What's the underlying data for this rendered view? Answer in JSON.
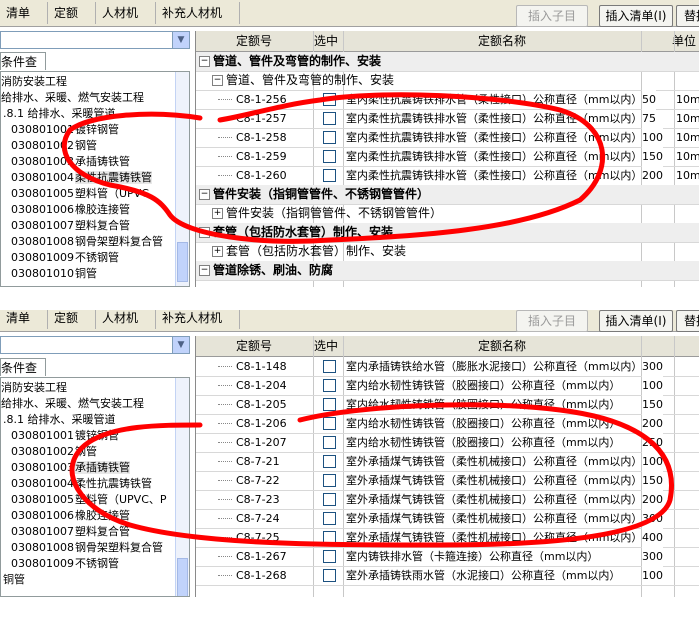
{
  "panels": [
    {
      "tabs": [
        "清单",
        "定额",
        "人材机",
        "补充人材机"
      ],
      "buttons": {
        "insert_child": "插入子目",
        "insert_list": "插入清单(I)",
        "replace": "替换"
      },
      "condition_tab": "条件查询",
      "tree": [
        {
          "code": "",
          "name": "消防安装工程"
        },
        {
          "code": "",
          "name": "给排水、采暖、燃气安装工程"
        },
        {
          "code": "",
          "name": ".8.1 给排水、采暖管道"
        },
        {
          "code": "030801001",
          "name": "镀锌钢管"
        },
        {
          "code": "030801002",
          "name": "钢管"
        },
        {
          "code": "030801003",
          "name": "承插铸铁管"
        },
        {
          "code": "030801004",
          "name": "柔性抗震铸铁管"
        },
        {
          "code": "030801005",
          "name": "塑料管（UPVC、"
        },
        {
          "code": "030801006",
          "name": "橡胶连接管"
        },
        {
          "code": "030801007",
          "name": "塑料复合管"
        },
        {
          "code": "030801008",
          "name": "钢骨架塑料复合管"
        },
        {
          "code": "030801009",
          "name": "不锈钢管"
        },
        {
          "code": "030801010",
          "name": "铜管"
        }
      ],
      "grid_header": {
        "code": "定额号",
        "select": "选中",
        "name": "定额名称",
        "unit": "单位"
      },
      "rows": [
        {
          "kind": "group",
          "code": "",
          "name": "管道、管件及弯管的制作、安装",
          "value": "",
          "unit": ""
        },
        {
          "kind": "subgroup",
          "code": "",
          "name": "管道、管件及弯管的制作、安装",
          "value": "",
          "unit": ""
        },
        {
          "kind": "item",
          "code": "C8-1-256",
          "name": "室内柔性抗震铸铁排水管（柔性接口）公称直径（mm以内）",
          "value": "50",
          "unit": "10m"
        },
        {
          "kind": "item",
          "code": "C8-1-257",
          "name": "室内柔性抗震铸铁排水管（柔性接口）公称直径（mm以内）",
          "value": "75",
          "unit": "10m"
        },
        {
          "kind": "item",
          "code": "C8-1-258",
          "name": "室内柔性抗震铸铁排水管（柔性接口）公称直径（mm以内）",
          "value": "100",
          "unit": "10m"
        },
        {
          "kind": "item",
          "code": "C8-1-259",
          "name": "室内柔性抗震铸铁排水管（柔性接口）公称直径（mm以内）",
          "value": "150",
          "unit": "10m"
        },
        {
          "kind": "item",
          "code": "C8-1-260",
          "name": "室内柔性抗震铸铁排水管（柔性接口）公称直径（mm以内）",
          "value": "200",
          "unit": "10m"
        },
        {
          "kind": "group",
          "code": "",
          "name": "管件安装（指铜管管件、不锈钢管管件）",
          "value": "",
          "unit": ""
        },
        {
          "kind": "subgroup",
          "code": "",
          "name": "管件安装（指铜管管件、不锈钢管管件）",
          "value": "",
          "unit": ""
        },
        {
          "kind": "group",
          "code": "",
          "name": "套管（包括防水套管）制作、安装",
          "value": "",
          "unit": ""
        },
        {
          "kind": "subgroup",
          "code": "",
          "name": "套管（包括防水套管）制作、安装",
          "value": "",
          "unit": ""
        },
        {
          "kind": "group",
          "code": "",
          "name": "管道除锈、刷油、防腐",
          "value": "",
          "unit": ""
        }
      ]
    },
    {
      "tabs": [
        "清单",
        "定额",
        "人材机",
        "补充人材机"
      ],
      "buttons": {
        "insert_child": "插入子目",
        "insert_list": "插入清单(I)",
        "replace": "替换"
      },
      "condition_tab": "条件查询",
      "tree": [
        {
          "code": "",
          "name": "消防安装工程"
        },
        {
          "code": "",
          "name": "给排水、采暖、燃气安装工程"
        },
        {
          "code": "",
          "name": ".8.1 给排水、采暖管道"
        },
        {
          "code": "030801001",
          "name": "镀锌钢管"
        },
        {
          "code": "030801002",
          "name": "钢管"
        },
        {
          "code": "030801003",
          "name": "承插铸铁管"
        },
        {
          "code": "030801004",
          "name": "柔性抗震铸铁管"
        },
        {
          "code": "030801005",
          "name": "塑料管（UPVC、P"
        },
        {
          "code": "030801006",
          "name": "橡胶连接管"
        },
        {
          "code": "030801007",
          "name": "塑料复合管"
        },
        {
          "code": "030801008",
          "name": "钢骨架塑料复合管"
        },
        {
          "code": "030801009",
          "name": "不锈钢管"
        },
        {
          "code": "",
          "name": "铜管"
        }
      ],
      "grid_header": {
        "code": "定额号",
        "select": "选中",
        "name": "定额名称",
        "unit": ""
      },
      "rows": [
        {
          "kind": "item",
          "code": "C8-1-148",
          "name": "室内承插铸铁给水管（膨胀水泥接口）公称直径（mm以内）",
          "value": "300",
          "unit": ""
        },
        {
          "kind": "item",
          "code": "C8-1-204",
          "name": "室内给水韧性铸铁管（胶圈接口）公称直径（mm以内）",
          "value": "100",
          "unit": ""
        },
        {
          "kind": "item",
          "code": "C8-1-205",
          "name": "室内给水韧性铸铁管（胶圈接口）公称直径（mm以内）",
          "value": "150",
          "unit": ""
        },
        {
          "kind": "item",
          "code": "C8-1-206",
          "name": "室内给水韧性铸铁管（胶圈接口）公称直径（mm以内）",
          "value": "200",
          "unit": ""
        },
        {
          "kind": "item",
          "code": "C8-1-207",
          "name": "室内给水韧性铸铁管（胶圈接口）公称直径（mm以内）",
          "value": "250",
          "unit": ""
        },
        {
          "kind": "item",
          "code": "C8-7-21",
          "name": "室外承插煤气铸铁管（柔性机械接口）公称直径（mm以内）",
          "value": "100",
          "unit": ""
        },
        {
          "kind": "item",
          "code": "C8-7-22",
          "name": "室外承插煤气铸铁管（柔性机械接口）公称直径（mm以内）",
          "value": "150",
          "unit": ""
        },
        {
          "kind": "item",
          "code": "C8-7-23",
          "name": "室外承插煤气铸铁管（柔性机械接口）公称直径（mm以内）",
          "value": "200",
          "unit": ""
        },
        {
          "kind": "item",
          "code": "C8-7-24",
          "name": "室外承插煤气铸铁管（柔性机械接口）公称直径（mm以内）",
          "value": "300",
          "unit": ""
        },
        {
          "kind": "item",
          "code": "C8-7-25",
          "name": "室外承插煤气铸铁管（柔性机械接口）公称直径（mm以内）",
          "value": "400",
          "unit": ""
        },
        {
          "kind": "item",
          "code": "C8-1-267",
          "name": "室内铸铁排水管（卡箍连接）公称直径（mm以内）",
          "value": "300",
          "unit": ""
        },
        {
          "kind": "item",
          "code": "C8-1-268",
          "name": "室外承插铸铁雨水管（水泥接口）公称直径（mm以内）",
          "value": "100",
          "unit": ""
        }
      ]
    }
  ],
  "colors": {
    "annotation": "#ff0000",
    "toolbar": "#ece9d8",
    "grid_header": "#e6e4d8",
    "group_row": "#eeeeee"
  }
}
